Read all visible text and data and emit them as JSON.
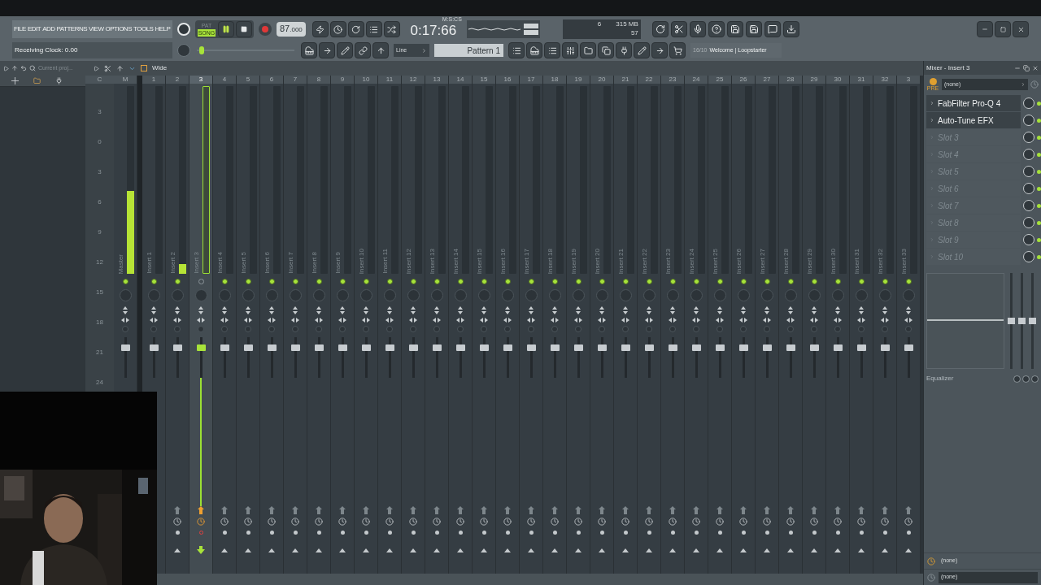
{
  "menu": [
    "FILE",
    "EDIT",
    "ADD",
    "PATTERNS",
    "VIEW",
    "OPTIONS",
    "TOOLS",
    "HELP"
  ],
  "hint_bar": "Receiving Clock: 0.00",
  "modes": [
    {
      "label": "PAT",
      "selected": false
    },
    {
      "label": "SONG",
      "selected": true
    }
  ],
  "tempo": {
    "whole": "87",
    "fraction": ".000"
  },
  "time": {
    "value": "0:17:66",
    "unit": "M:S:CS"
  },
  "cpu": {
    "polyphony": "6",
    "memory": "315 MB",
    "load": "57"
  },
  "pitch": {
    "level": 0.05
  },
  "snap": "Line",
  "pattern": "Pattern 1",
  "news": {
    "count": "16/10",
    "text": "Welcome | Loopstarter"
  },
  "browser": {
    "title": "Current proj..."
  },
  "mixer": {
    "stereo_mode": "Wide",
    "scale_header": "C",
    "scale": [
      "3",
      "0",
      "3",
      "6",
      "9",
      "12",
      "15",
      "18",
      "21",
      "24"
    ],
    "strips": [
      {
        "header": "M",
        "label": "Master",
        "selected": false,
        "enabled": true,
        "meter": {
          "level": 0.44
        },
        "fader": {
          "level": 0.75
        }
      },
      {
        "header": "1",
        "label": "Insert 1",
        "selected": false,
        "enabled": true,
        "fader": {
          "level": 0.75
        }
      },
      {
        "header": "2",
        "label": "Insert 2",
        "selected": false,
        "enabled": true,
        "routed": false,
        "meter": {
          "level": 0.05
        },
        "fader": {
          "level": 0.75
        }
      },
      {
        "header": "3",
        "label": "Insert 3",
        "selected": true,
        "enabled": false,
        "routed": true,
        "fader": {
          "level": 0.75
        }
      },
      {
        "header": "4",
        "label": "Insert 4",
        "selected": false,
        "enabled": true,
        "routed": false,
        "fader": {
          "level": 0.75
        }
      },
      {
        "header": "5",
        "label": "Insert 5",
        "selected": false,
        "enabled": true,
        "routed": false,
        "fader": {
          "level": 0.75
        }
      },
      {
        "header": "6",
        "label": "Insert 6",
        "selected": false,
        "enabled": true,
        "routed": false,
        "fader": {
          "level": 0.75
        }
      },
      {
        "header": "7",
        "label": "Insert 7",
        "selected": false,
        "enabled": true,
        "routed": false,
        "fader": {
          "level": 0.75
        }
      },
      {
        "header": "8",
        "label": "Insert 8",
        "selected": false,
        "enabled": true,
        "routed": false,
        "fader": {
          "level": 0.75
        }
      },
      {
        "header": "9",
        "label": "Insert 9",
        "selected": false,
        "enabled": true,
        "routed": false,
        "fader": {
          "level": 0.75
        }
      },
      {
        "header": "10",
        "label": "Insert 10",
        "selected": false,
        "enabled": true,
        "routed": false,
        "fader": {
          "level": 0.75
        }
      },
      {
        "header": "11",
        "label": "Insert 11",
        "selected": false,
        "enabled": true,
        "routed": false,
        "fader": {
          "level": 0.75
        }
      },
      {
        "header": "12",
        "label": "Insert 12",
        "selected": false,
        "enabled": true,
        "routed": false,
        "fader": {
          "level": 0.75
        }
      },
      {
        "header": "13",
        "label": "Insert 13",
        "selected": false,
        "enabled": true,
        "routed": false,
        "fader": {
          "level": 0.75
        }
      },
      {
        "header": "14",
        "label": "Insert 14",
        "selected": false,
        "enabled": true,
        "routed": false,
        "fader": {
          "level": 0.75
        }
      },
      {
        "header": "15",
        "label": "Insert 15",
        "selected": false,
        "enabled": true,
        "routed": false,
        "fader": {
          "level": 0.75
        }
      },
      {
        "header": "16",
        "label": "Insert 16",
        "selected": false,
        "enabled": true,
        "routed": false,
        "fader": {
          "level": 0.75
        }
      },
      {
        "header": "17",
        "label": "Insert 17",
        "selected": false,
        "enabled": true,
        "routed": false,
        "fader": {
          "level": 0.75
        }
      },
      {
        "header": "18",
        "label": "Insert 18",
        "selected": false,
        "enabled": true,
        "routed": false,
        "fader": {
          "level": 0.75
        }
      },
      {
        "header": "19",
        "label": "Insert 19",
        "selected": false,
        "enabled": true,
        "routed": false,
        "fader": {
          "level": 0.75
        }
      },
      {
        "header": "20",
        "label": "Insert 20",
        "selected": false,
        "enabled": true,
        "routed": false,
        "fader": {
          "level": 0.75
        }
      },
      {
        "header": "21",
        "label": "Insert 21",
        "selected": false,
        "enabled": true,
        "routed": false,
        "fader": {
          "level": 0.75
        }
      },
      {
        "header": "22",
        "label": "Insert 22",
        "selected": false,
        "enabled": true,
        "routed": false,
        "fader": {
          "level": 0.75
        }
      },
      {
        "header": "23",
        "label": "Insert 23",
        "selected": false,
        "enabled": true,
        "routed": false,
        "fader": {
          "level": 0.75
        }
      },
      {
        "header": "24",
        "label": "Insert 24",
        "selected": false,
        "enabled": true,
        "routed": false,
        "fader": {
          "level": 0.75
        }
      },
      {
        "header": "25",
        "label": "Insert 25",
        "selected": false,
        "enabled": true,
        "routed": false,
        "fader": {
          "level": 0.75
        }
      },
      {
        "header": "26",
        "label": "Insert 26",
        "selected": false,
        "enabled": true,
        "routed": false,
        "fader": {
          "level": 0.75
        }
      },
      {
        "header": "27",
        "label": "Insert 27",
        "selected": false,
        "enabled": true,
        "routed": false,
        "fader": {
          "level": 0.75
        }
      },
      {
        "header": "28",
        "label": "Insert 28",
        "selected": false,
        "enabled": true,
        "routed": false,
        "fader": {
          "level": 0.75
        }
      },
      {
        "header": "29",
        "label": "Insert 29",
        "selected": false,
        "enabled": true,
        "routed": false,
        "fader": {
          "level": 0.75
        }
      },
      {
        "header": "30",
        "label": "Insert 30",
        "selected": false,
        "enabled": true,
        "routed": false,
        "fader": {
          "level": 0.75
        }
      },
      {
        "header": "31",
        "label": "Insert 31",
        "selected": false,
        "enabled": true,
        "routed": false,
        "fader": {
          "level": 0.75
        }
      },
      {
        "header": "32",
        "label": "Insert 32",
        "selected": false,
        "enabled": true,
        "routed": false,
        "fader": {
          "level": 0.75
        }
      },
      {
        "header": "3",
        "label": "Insert 33",
        "selected": false,
        "enabled": true,
        "routed": false,
        "fader": {
          "level": 0.75
        }
      }
    ]
  },
  "insert_panel": {
    "title": "Mixer - Insert 3",
    "input": "(none)",
    "pre_label": "PRE",
    "slots": [
      {
        "name": "FabFilter Pro-Q 4",
        "filled": true
      },
      {
        "name": "Auto-Tune EFX",
        "filled": true
      },
      {
        "name": "Slot 3",
        "filled": false
      },
      {
        "name": "Slot 4",
        "filled": false
      },
      {
        "name": "Slot 5",
        "filled": false
      },
      {
        "name": "Slot 6",
        "filled": false
      },
      {
        "name": "Slot 7",
        "filled": false
      },
      {
        "name": "Slot 8",
        "filled": false
      },
      {
        "name": "Slot 9",
        "filled": false
      },
      {
        "name": "Slot 10",
        "filled": false
      }
    ],
    "eq_sliders": [
      {
        "level": 0.5
      },
      {
        "level": 0.5
      },
      {
        "level": 0.5
      }
    ],
    "eq_label": "Equalizer",
    "outputs": [
      "(none)",
      "(none)"
    ]
  }
}
